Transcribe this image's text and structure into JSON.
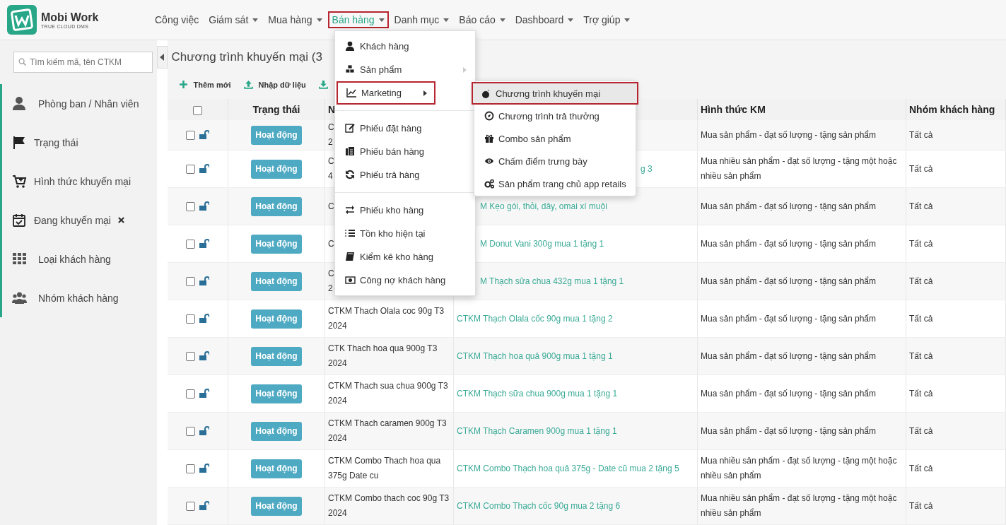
{
  "app": {
    "logo_title": "Mobi Work",
    "logo_subtitle": "TRUE CLOUD DMS"
  },
  "nav": [
    {
      "label": "Công việc",
      "dropdown": false,
      "selected": false
    },
    {
      "label": "Giám sát",
      "dropdown": true,
      "selected": false
    },
    {
      "label": "Mua hàng",
      "dropdown": true,
      "selected": false
    },
    {
      "label": "Bán hàng",
      "dropdown": true,
      "selected": true
    },
    {
      "label": "Danh mục",
      "dropdown": true,
      "selected": false
    },
    {
      "label": "Báo cáo",
      "dropdown": true,
      "selected": false
    },
    {
      "label": "Dashboard",
      "dropdown": true,
      "selected": false
    },
    {
      "label": "Trợ giúp",
      "dropdown": true,
      "selected": false
    }
  ],
  "sidebar": {
    "search": {
      "placeholder": "Tìm kiếm mã, tên CTKM"
    },
    "items": [
      {
        "label": "Phòng ban / Nhân viên",
        "removable": false
      },
      {
        "label": "Trạng thái",
        "removable": false
      },
      {
        "label": "Hình thức khuyến mại",
        "removable": false
      },
      {
        "label": "Đang khuyến mại",
        "removable": true
      },
      {
        "label": "Loại khách hàng",
        "removable": false
      },
      {
        "label": "Nhóm khách hàng",
        "removable": false
      }
    ]
  },
  "page": {
    "title": "Chương trình khuyến mại (3",
    "toolbar": [
      {
        "kind": "text",
        "label": "Thêm mới"
      },
      {
        "kind": "text",
        "label": "Nhập dữ liệu"
      },
      {
        "kind": "icon"
      }
    ]
  },
  "table": {
    "select_all": {
      "checked": false
    },
    "columns": [
      {
        "kind": "checkbox"
      },
      {
        "kind": "text",
        "label": "Trạng thái"
      },
      {
        "kind": "text",
        "label": "N"
      },
      {
        "kind": "blank"
      },
      {
        "kind": "text",
        "label": "Hình thức KM"
      },
      {
        "kind": "text",
        "label": "Nhóm khách hàng"
      }
    ],
    "rows": [
      {
        "checked": false,
        "locked": false,
        "status": "Hoạt động",
        "name": [
          "C",
          "2"
        ],
        "type": "Mua sản phẩm - đạt số lượng - tặng sản phẩm",
        "group": "Tất cả"
      },
      {
        "checked": false,
        "locked": false,
        "status": "Hoạt động",
        "name": [
          "C",
          "4"
        ],
        "program": "g 3",
        "type": "Mua nhiều sản phẩm - đạt số lượng - tặng một hoặc nhiều sản phẩm",
        "group": "Tất cả"
      },
      {
        "checked": false,
        "locked": false,
        "status": "Hoạt động",
        "name": [
          "C"
        ],
        "program": "M Kẹo gói, thỏi, dây, omai xí muội",
        "type": "Mua sản phẩm - đạt số lượng - tặng sản phẩm",
        "group": "Tất cả"
      },
      {
        "checked": false,
        "locked": false,
        "status": "Hoạt động",
        "name": [
          "C"
        ],
        "program": "M Donut Vani 300g mua 1 tặng 1",
        "type": "Mua sản phẩm - đạt số lượng - tặng sản phẩm",
        "group": "Tất cả"
      },
      {
        "checked": false,
        "locked": false,
        "status": "Hoạt động",
        "name": [
          "C",
          "2"
        ],
        "program": "M Thạch sữa chua 432g mua 1 tặng 1",
        "type": "Mua sản phẩm - đạt số lượng - tặng sản phẩm",
        "group": "Tất cả"
      },
      {
        "checked": false,
        "locked": false,
        "status": "Hoạt động",
        "name": [
          "CTKM Thach Olala coc 90g T3 2024"
        ],
        "program": "CTKM Thạch Olala cốc 90g mua 1 tặng 2",
        "type": "Mua sản phẩm - đạt số lượng - tặng sản phẩm",
        "group": "Tất cả"
      },
      {
        "checked": false,
        "locked": false,
        "status": "Hoạt động",
        "name": [
          "CTK Thach hoa qua 900g T3 2024"
        ],
        "program": "CTKM Thạch hoa quả 900g mua 1 tặng 1",
        "type": "Mua sản phẩm - đạt số lượng - tặng sản phẩm",
        "group": "Tất cả"
      },
      {
        "checked": false,
        "locked": false,
        "status": "Hoạt động",
        "name": [
          "CTKM Thach sua chua 900g T3 2024"
        ],
        "program": "CTKM Thạch sữa chua 900g mua 1 tặng 1",
        "type": "Mua sản phẩm - đạt số lượng - tặng sản phẩm",
        "group": "Tất cả"
      },
      {
        "checked": false,
        "locked": false,
        "status": "Hoạt động",
        "name": [
          "CTKM Thach caramen 900g T3 2024"
        ],
        "program": "CTKM Thạch Caramen 900g mua 1 tặng 1",
        "type": "Mua sản phẩm - đạt số lượng - tặng sản phẩm",
        "group": "Tất cả"
      },
      {
        "checked": false,
        "locked": false,
        "status": "Hoạt động",
        "name": [
          "CTKM Combo Thach hoa qua 375g Date cu"
        ],
        "program": "CTKM Combo Thạch hoa quả 375g - Date cũ mua 2 tặng 5",
        "type": "Mua nhiều sản phẩm - đạt số lượng - tặng một hoặc nhiều sản phẩm",
        "group": "Tất cả"
      },
      {
        "checked": false,
        "locked": false,
        "status": "Hoạt động",
        "name": [
          "CTKM Combo thach coc 90g T3 2024"
        ],
        "program": "CTKM Combo Thạch cốc 90g mua 2 tặng 6",
        "type": "Mua nhiều sản phẩm - đạt số lượng - tặng một hoặc nhiều sản phẩm",
        "group": "Tất cả"
      }
    ]
  },
  "menu": {
    "sections": [
      {
        "items": [
          {
            "label": "Khách hàng",
            "submenu": false,
            "selected": false
          },
          {
            "label": "Sản phẩm",
            "submenu": true,
            "selected": false
          },
          {
            "label": "Marketing",
            "submenu": true,
            "selected": true
          }
        ]
      },
      {
        "items": [
          {
            "label": "Phiếu đặt hàng",
            "submenu": false,
            "selected": false
          },
          {
            "label": "Phiếu bán hàng",
            "submenu": false,
            "selected": false
          },
          {
            "label": "Phiếu trả hàng",
            "submenu": false,
            "selected": false
          }
        ]
      },
      {
        "items": [
          {
            "label": "Phiếu kho hàng",
            "submenu": false,
            "selected": false
          },
          {
            "label": "Tồn kho hiện tại",
            "submenu": false,
            "selected": false
          },
          {
            "label": "Kiểm kê kho hàng",
            "submenu": false,
            "selected": false
          },
          {
            "label": "Công nợ khách hàng",
            "submenu": false,
            "selected": false
          }
        ]
      }
    ]
  },
  "submenu": {
    "items": [
      {
        "label": "Chương trình khuyến mại",
        "selected": true
      },
      {
        "label": "Chương trình trả thưởng",
        "selected": false
      },
      {
        "label": "Combo sản phẩm",
        "selected": false
      },
      {
        "label": "Chấm điểm trưng bày",
        "selected": false
      },
      {
        "label": "Sản phẩm trang chủ app retails",
        "selected": false
      }
    ]
  }
}
